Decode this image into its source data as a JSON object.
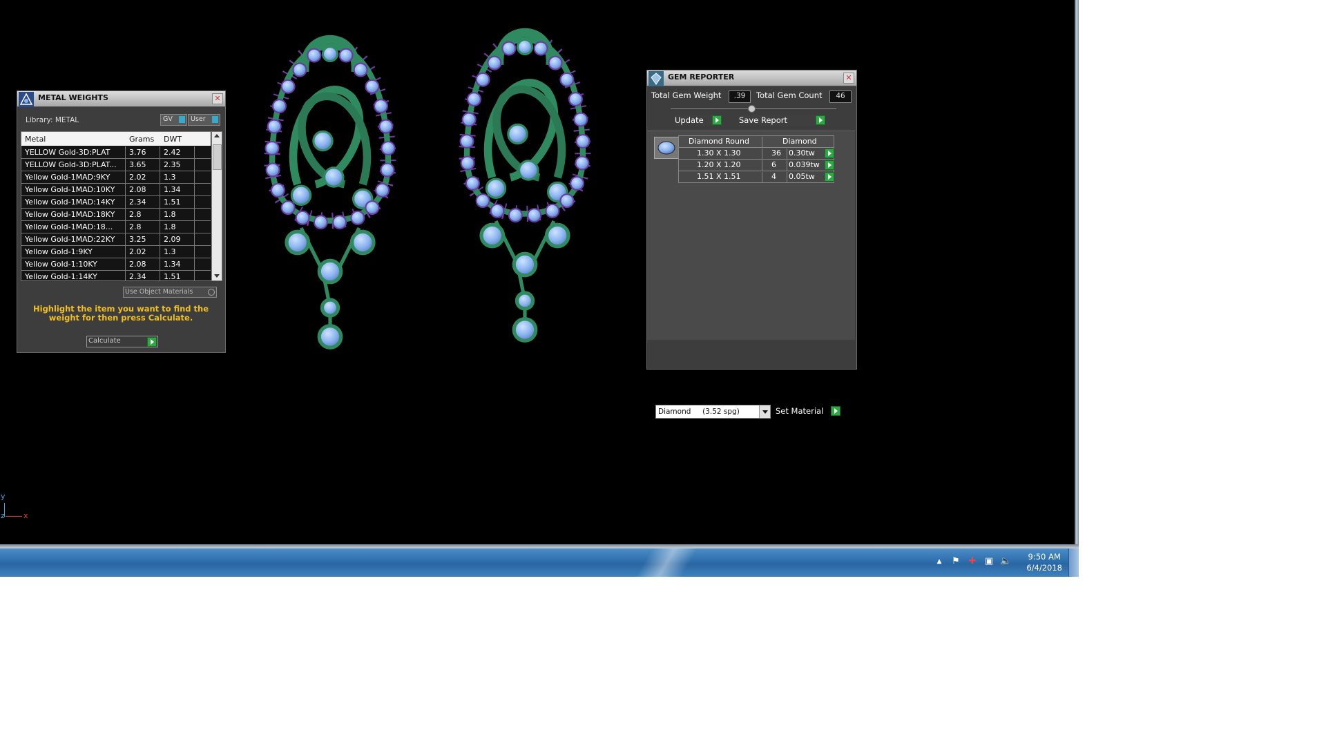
{
  "metal_weights": {
    "title": "METAL WEIGHTS",
    "library_label": "Library: METAL",
    "gv_label": "GV",
    "user_label": "User",
    "columns": [
      "Metal",
      "Grams",
      "DWT"
    ],
    "rows": [
      {
        "metal": "YELLOW Gold-3D:PLAT",
        "grams": "3.76",
        "dwt": "2.42"
      },
      {
        "metal": "YELLOW Gold-3D:PLAT...",
        "grams": "3.65",
        "dwt": "2.35"
      },
      {
        "metal": "Yellow Gold-1MAD:9KY",
        "grams": "2.02",
        "dwt": "1.3"
      },
      {
        "metal": "Yellow Gold-1MAD:10KY",
        "grams": "2.08",
        "dwt": "1.34"
      },
      {
        "metal": "Yellow Gold-1MAD:14KY",
        "grams": "2.34",
        "dwt": "1.51"
      },
      {
        "metal": "Yellow Gold-1MAD:18KY",
        "grams": "2.8",
        "dwt": "1.8"
      },
      {
        "metal": "Yellow Gold-1MAD:18...",
        "grams": "2.8",
        "dwt": "1.8"
      },
      {
        "metal": "Yellow Gold-1MAD:22KY",
        "grams": "3.25",
        "dwt": "2.09"
      },
      {
        "metal": "Yellow Gold-1:9KY",
        "grams": "2.02",
        "dwt": "1.3"
      },
      {
        "metal": "Yellow Gold-1:10KY",
        "grams": "2.08",
        "dwt": "1.34"
      },
      {
        "metal": "Yellow Gold-1:14KY",
        "grams": "2.34",
        "dwt": "1.51"
      }
    ],
    "use_object_materials": "Use Object Materials",
    "instruction": "Highlight the item you want to find the weight for then press Calculate.",
    "calculate_label": "Calculate"
  },
  "gem_reporter": {
    "title": "GEM REPORTER",
    "total_weight_label": "Total Gem Weight",
    "total_weight_value": ".39",
    "total_count_label": "Total Gem Count",
    "total_count_value": "46",
    "update_label": "Update",
    "save_report_label": "Save Report",
    "columns": [
      "Diamond Round",
      "Diamond"
    ],
    "rows": [
      {
        "size": "1.30 X 1.30",
        "count": "36",
        "weight": "0.30tw"
      },
      {
        "size": "1.20 X 1.20",
        "count": "6",
        "weight": "0.039tw"
      },
      {
        "size": "1.51 X 1.51",
        "count": "4",
        "weight": "0.05tw"
      }
    ],
    "material_value": "Diamond     (3.52 spg)",
    "set_material_label": "Set Material"
  },
  "axis": {
    "y": "y",
    "z": "z",
    "x": "x"
  },
  "taskbar": {
    "time": "9:50 AM",
    "date": "6/4/2018"
  },
  "colors": {
    "viewport_bg": "#000000",
    "metal": "#2f8a60",
    "gem": "#8ab4f0",
    "prong": "#7a2fa8",
    "accent_text": "#f2c01e"
  }
}
